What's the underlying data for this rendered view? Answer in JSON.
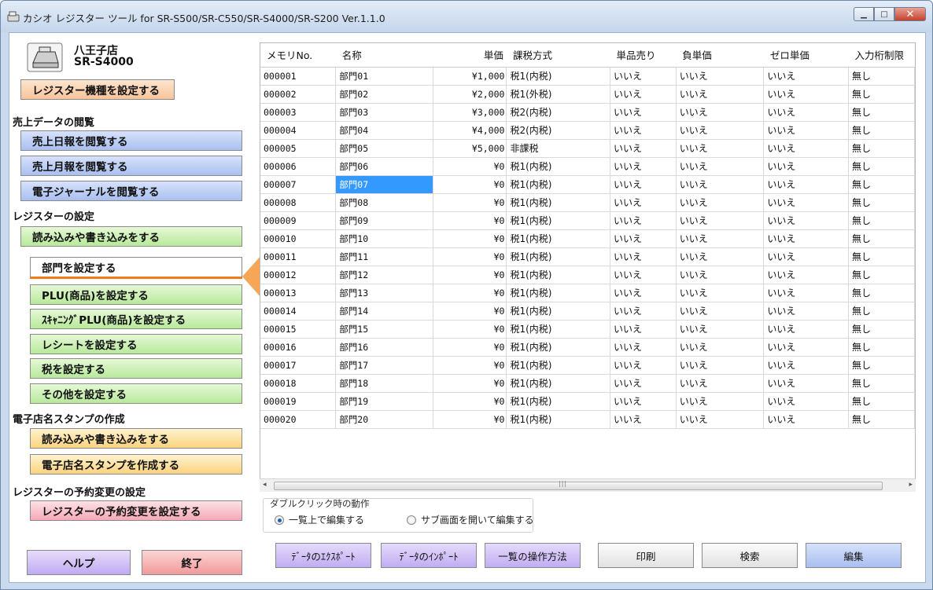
{
  "window": {
    "title": "カシオ レジスター ツール for SR-S500/SR-C550/SR-S4000/SR-S200 Ver.1.1.0",
    "buttons": {
      "minimize": "▁",
      "maximize": "□",
      "close": "✕"
    }
  },
  "sidebar": {
    "store_name": "八王子店",
    "model": "SR-S4000",
    "set_model_button": "レジスター機種を設定する",
    "sections": [
      {
        "label": "売上データの閲覧"
      },
      {
        "label": "レジスターの設定"
      },
      {
        "label": "電子店名スタンプの作成"
      },
      {
        "label": "レジスターの予約変更の設定"
      }
    ],
    "sales_buttons": [
      "売上日報を閲覧する",
      "売上月報を閲覧する",
      "電子ジャーナルを閲覧する"
    ],
    "register_buttons": [
      "読み込みや書き込みをする",
      "部門を設定する",
      "PLU(商品)を設定する",
      "ｽｷｬﾆﾝｸﾞPLU(商品)を設定する",
      "レシートを設定する",
      "税を設定する",
      "その他を設定する"
    ],
    "stamp_buttons": [
      "読み込みや書き込みをする",
      "電子店名スタンプを作成する"
    ],
    "reservation_button": "レジスターの予約変更を設定する",
    "help_button": "ヘルプ",
    "exit_button": "終了",
    "active_item": "部門を設定する"
  },
  "grid": {
    "columns": [
      "メモリNo.",
      "名称",
      "単価",
      "課税方式",
      "単品売り",
      "負単価",
      "ゼロ単価",
      "入力桁制限"
    ],
    "rows": [
      [
        "000001",
        "部門01",
        "¥1,000",
        "税1(内税)",
        "いいえ",
        "いいえ",
        "いいえ",
        "無し"
      ],
      [
        "000002",
        "部門02",
        "¥2,000",
        "税1(外税)",
        "いいえ",
        "いいえ",
        "いいえ",
        "無し"
      ],
      [
        "000003",
        "部門03",
        "¥3,000",
        "税2(内税)",
        "いいえ",
        "いいえ",
        "いいえ",
        "無し"
      ],
      [
        "000004",
        "部門04",
        "¥4,000",
        "税2(内税)",
        "いいえ",
        "いいえ",
        "いいえ",
        "無し"
      ],
      [
        "000005",
        "部門05",
        "¥5,000",
        "非課税",
        "いいえ",
        "いいえ",
        "いいえ",
        "無し"
      ],
      [
        "000006",
        "部門06",
        "¥0",
        "税1(内税)",
        "いいえ",
        "いいえ",
        "いいえ",
        "無し"
      ],
      [
        "000007",
        "部門07",
        "¥0",
        "税1(内税)",
        "いいえ",
        "いいえ",
        "いいえ",
        "無し"
      ],
      [
        "000008",
        "部門08",
        "¥0",
        "税1(内税)",
        "いいえ",
        "いいえ",
        "いいえ",
        "無し"
      ],
      [
        "000009",
        "部門09",
        "¥0",
        "税1(内税)",
        "いいえ",
        "いいえ",
        "いいえ",
        "無し"
      ],
      [
        "000010",
        "部門10",
        "¥0",
        "税1(内税)",
        "いいえ",
        "いいえ",
        "いいえ",
        "無し"
      ],
      [
        "000011",
        "部門11",
        "¥0",
        "税1(内税)",
        "いいえ",
        "いいえ",
        "いいえ",
        "無し"
      ],
      [
        "000012",
        "部門12",
        "¥0",
        "税1(内税)",
        "いいえ",
        "いいえ",
        "いいえ",
        "無し"
      ],
      [
        "000013",
        "部門13",
        "¥0",
        "税1(内税)",
        "いいえ",
        "いいえ",
        "いいえ",
        "無し"
      ],
      [
        "000014",
        "部門14",
        "¥0",
        "税1(内税)",
        "いいえ",
        "いいえ",
        "いいえ",
        "無し"
      ],
      [
        "000015",
        "部門15",
        "¥0",
        "税1(内税)",
        "いいえ",
        "いいえ",
        "いいえ",
        "無し"
      ],
      [
        "000016",
        "部門16",
        "¥0",
        "税1(内税)",
        "いいえ",
        "いいえ",
        "いいえ",
        "無し"
      ],
      [
        "000017",
        "部門17",
        "¥0",
        "税1(内税)",
        "いいえ",
        "いいえ",
        "いいえ",
        "無し"
      ],
      [
        "000018",
        "部門18",
        "¥0",
        "税1(内税)",
        "いいえ",
        "いいえ",
        "いいえ",
        "無し"
      ],
      [
        "000019",
        "部門19",
        "¥0",
        "税1(内税)",
        "いいえ",
        "いいえ",
        "いいえ",
        "無し"
      ],
      [
        "000020",
        "部門20",
        "¥0",
        "税1(内税)",
        "いいえ",
        "いいえ",
        "いいえ",
        "無し"
      ]
    ],
    "selected_cell": {
      "row": "000007",
      "column": "名称"
    }
  },
  "double_click": {
    "label": "ダブルクリック時の動作",
    "options": [
      "一覧上で編集する",
      "サブ画面を開いて編集する"
    ],
    "selected": "一覧上で編集する"
  },
  "actions": [
    "ﾃﾞｰﾀのｴｸｽﾎﾟｰﾄ",
    "ﾃﾞｰﾀのｲﾝﾎﾟｰﾄ",
    "一覧の操作方法",
    "印刷",
    "検索",
    "編集"
  ],
  "colors": {
    "accent": "#f07d1a",
    "selection": "#3399ff"
  }
}
